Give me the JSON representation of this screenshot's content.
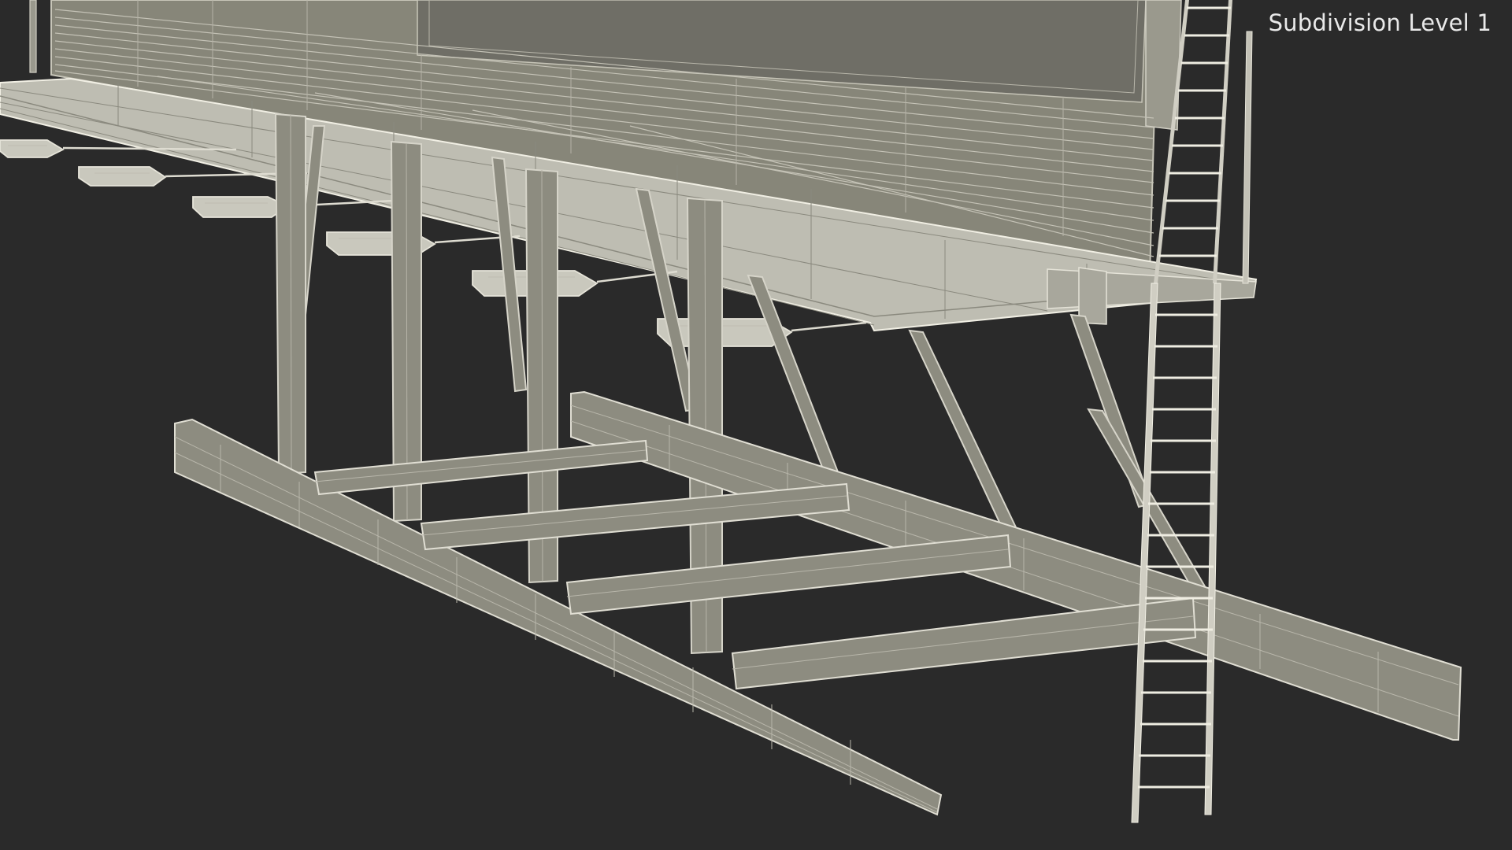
{
  "viewport": {
    "subdivision_label": "Subdivision Level 1"
  },
  "scene": {
    "background_color": "#2a2a2a",
    "board_color": "#878679",
    "wire_color": "#c7c5b8",
    "structure_fill": "#8d8c80",
    "light_fill": "#bebdb2"
  }
}
